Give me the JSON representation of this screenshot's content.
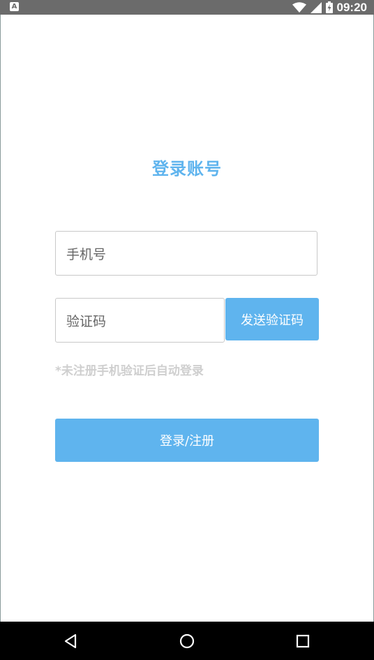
{
  "status_bar": {
    "left_icon_letter": "A",
    "time": "09:20"
  },
  "login": {
    "title": "登录账号",
    "phone_placeholder": "手机号",
    "code_placeholder": "验证码",
    "send_code_label": "发送验证码",
    "hint": "*未注册手机验证后自动登录",
    "submit_label": "登录/注册"
  },
  "nav_bar": {
    "icons": [
      "back-icon",
      "home-icon",
      "recents-icon"
    ]
  },
  "colors": {
    "accent": "#5fb4ee",
    "status_bar": "#6b6b6b",
    "hint": "#cfcfcf",
    "nav_bar": "#000000"
  }
}
